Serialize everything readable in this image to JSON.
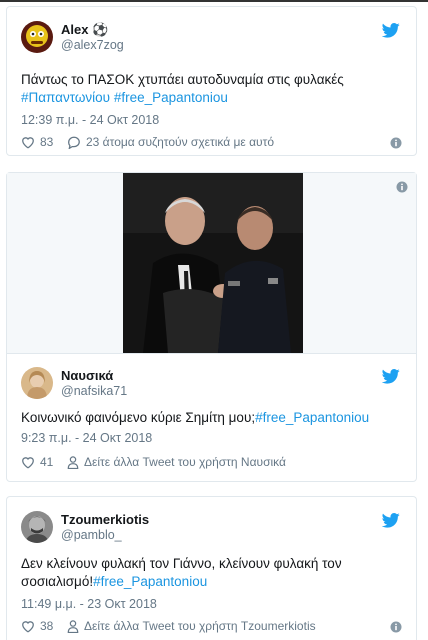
{
  "tweets": [
    {
      "name": "Alex",
      "name_suffix": "⚽",
      "handle": "@alex7zog",
      "text": "Πάντως το ΠΑΣΟΚ χτυπάει αυτοδυναμία στις φυλακές",
      "hashtags_line": "#Παπαντωνίου #free_Papantoniou",
      "time": "12:39 π.μ. - 24 Οκτ 2018",
      "likes": "83",
      "discussion": "23 άτομα συζητούν σχετικά με αυτό"
    },
    {
      "name": "Ναυσικά",
      "handle": "@nafsika71",
      "text": "Κοινωνικό φαινόμενο κύριε Σημίτη μου;",
      "hashtag": "#free_Papantoniou",
      "time": "9:23 π.μ. - 24 Οκτ 2018",
      "likes": "41",
      "more": "Δείτε άλλα Tweet του χρήστη Ναυσικά"
    },
    {
      "name": "Tzoumerkiotis",
      "handle": "@pamblo_",
      "text_line1": "Δεν κλείνουν φυλακή τον Γιάννο, κλείνουν φυλακή τον",
      "text_line2": "σοσιαλισμό!",
      "hashtag": "#free_Papantoniou",
      "time": "11:49 μ.μ. - 23 Οκτ 2018",
      "likes": "38",
      "more": "Δείτε άλλα Tweet του χρήστη Tzoumerkiotis"
    }
  ],
  "colors": {
    "twitter_blue": "#1da1f2",
    "hashtag": "#1b95e0",
    "muted": "#657786",
    "border": "#e1e8ed"
  },
  "icons": [
    "twitter-bird-icon",
    "heart-icon",
    "reply-bubble-icon",
    "person-icon",
    "info-icon"
  ]
}
